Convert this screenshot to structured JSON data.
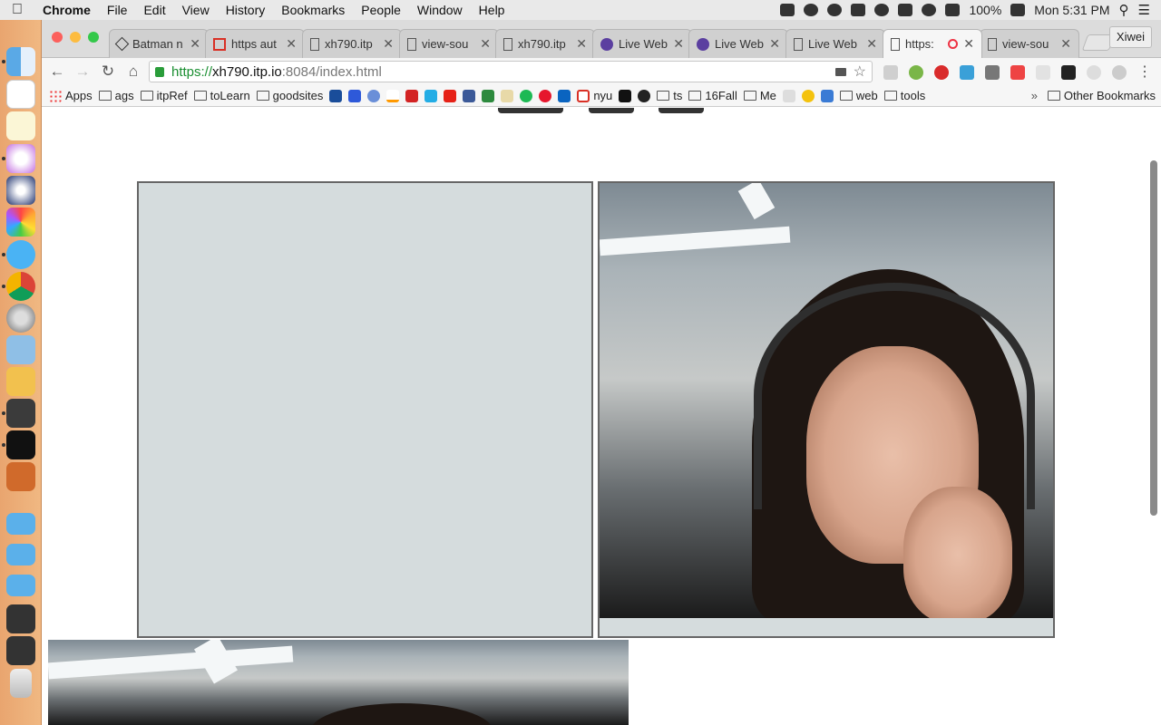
{
  "menubar": {
    "app_name": "Chrome",
    "items": [
      "File",
      "Edit",
      "View",
      "History",
      "Bookmarks",
      "People",
      "Window",
      "Help"
    ],
    "battery": "100%",
    "clock": "Mon 5:31 PM"
  },
  "tabs": [
    {
      "label": "Batman n"
    },
    {
      "label": "https aut"
    },
    {
      "label": "xh790.itp"
    },
    {
      "label": "view-sou"
    },
    {
      "label": "xh790.itp"
    },
    {
      "label": "Live Web"
    },
    {
      "label": "Live Web"
    },
    {
      "label": "Live Web"
    },
    {
      "label": "https:"
    },
    {
      "label": "view-sou"
    }
  ],
  "profile_name": "Xiwei",
  "address": {
    "scheme": "https://",
    "host": "xh790.itp.io",
    "path": ":8084/index.html"
  },
  "bookmarks": [
    {
      "label": "Apps",
      "kind": "apps"
    },
    {
      "label": "ags",
      "kind": "folder"
    },
    {
      "label": "itpRef",
      "kind": "folder"
    },
    {
      "label": "toLearn",
      "kind": "folder"
    },
    {
      "label": "goodsites",
      "kind": "folder"
    },
    {
      "label": "nyu",
      "kind": "gmail"
    },
    {
      "label": "ts",
      "kind": "folder"
    },
    {
      "label": "16Fall",
      "kind": "folder"
    },
    {
      "label": "Me",
      "kind": "folder"
    },
    {
      "label": "web",
      "kind": "folder"
    },
    {
      "label": "tools",
      "kind": "folder"
    }
  ],
  "other_bookmarks": "Other Bookmarks",
  "colors": {
    "video_bg": "#d5dcdd",
    "video_border": "#666666",
    "dock": "#e9a56f"
  }
}
